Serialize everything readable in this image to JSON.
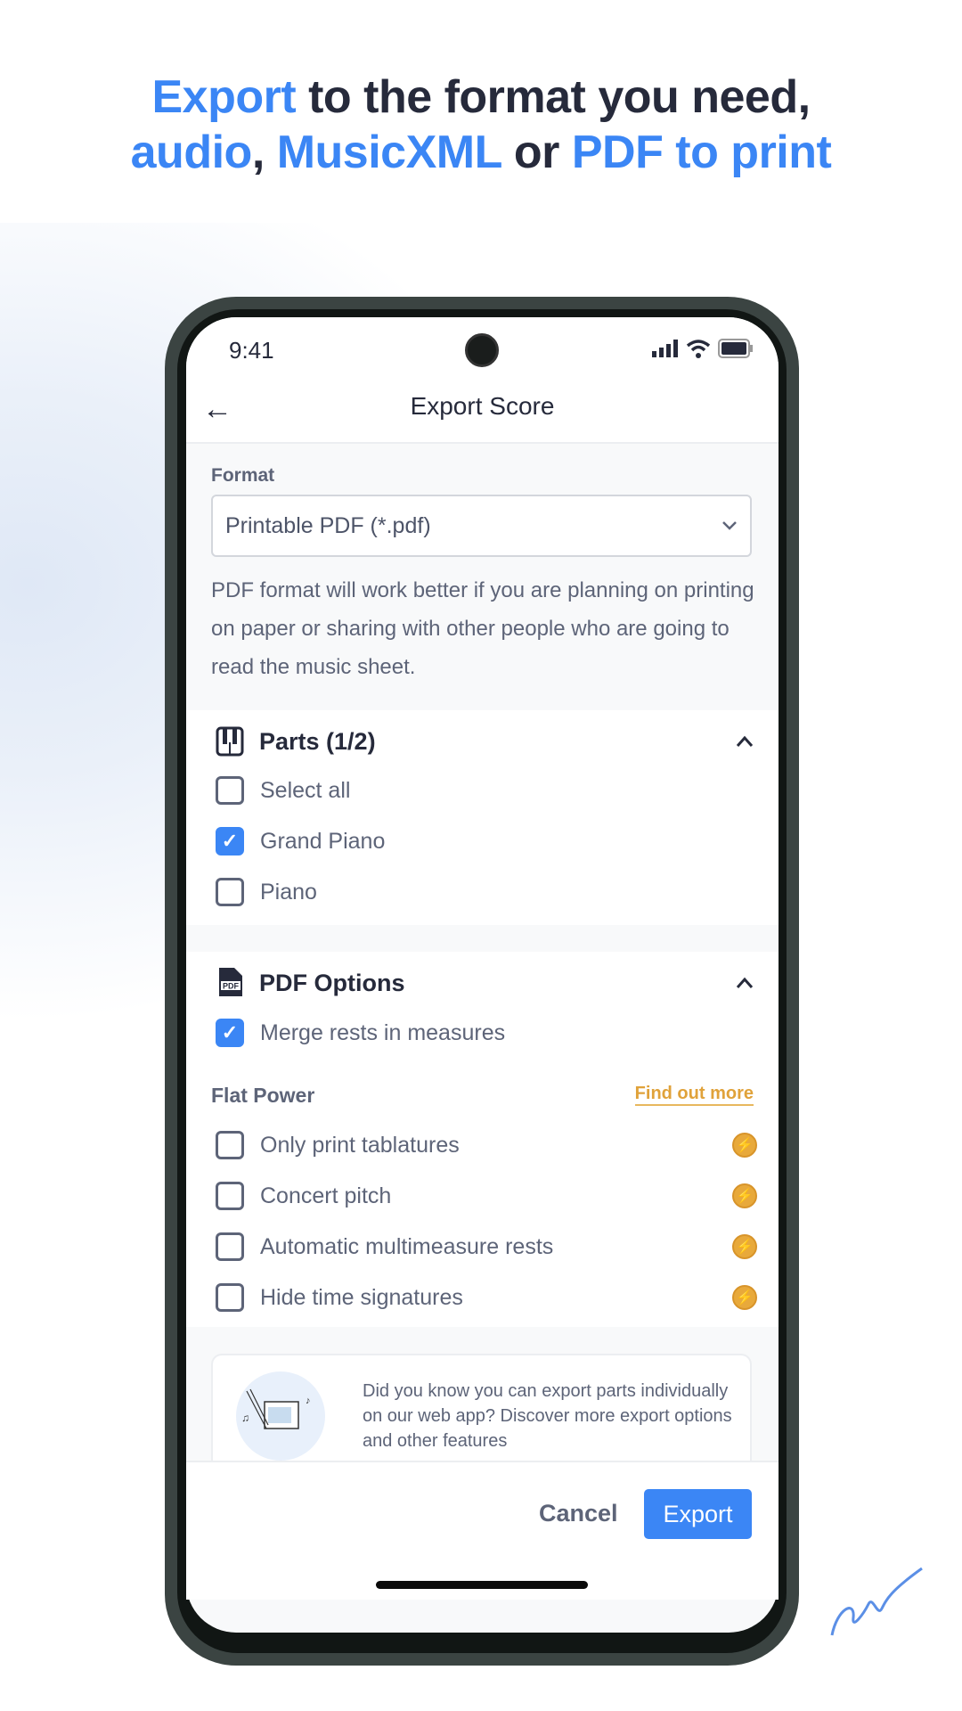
{
  "headline": {
    "w1": "Export",
    "w2": " to the format you need,",
    "w3": "audio",
    "w4": ", ",
    "w5": "MusicXML",
    "w6": " or ",
    "w7": "PDF to print"
  },
  "status": {
    "time": "9:41"
  },
  "header": {
    "title": "Export Score",
    "back_icon": "arrow-left-icon"
  },
  "format": {
    "label": "Format",
    "value": "Printable PDF (*.pdf)",
    "description": "PDF format will work better if you are planning on printing on paper or sharing with other people who are going to read the music sheet."
  },
  "parts": {
    "title": "Parts (1/2)",
    "items": [
      {
        "label": "Select all",
        "checked": false
      },
      {
        "label": "Grand Piano",
        "checked": true
      },
      {
        "label": "Piano",
        "checked": false
      }
    ]
  },
  "pdf_options": {
    "title": "PDF Options",
    "merge": {
      "label": "Merge rests in measures",
      "checked": true
    },
    "flat_power": {
      "label": "Flat Power",
      "link": "Find out more",
      "items": [
        {
          "label": "Only print tablatures",
          "checked": false
        },
        {
          "label": "Concert pitch",
          "checked": false
        },
        {
          "label": "Automatic multimeasure rests",
          "checked": false
        },
        {
          "label": "Hide time signatures",
          "checked": false
        }
      ]
    }
  },
  "promo": {
    "text": "Did you know you can export parts individually on our web app? Discover more export options and other features"
  },
  "footer": {
    "cancel": "Cancel",
    "export": "Export"
  },
  "colors": {
    "accent": "#3b86f5",
    "power": "#e8a93b",
    "text": "#262a3b"
  }
}
